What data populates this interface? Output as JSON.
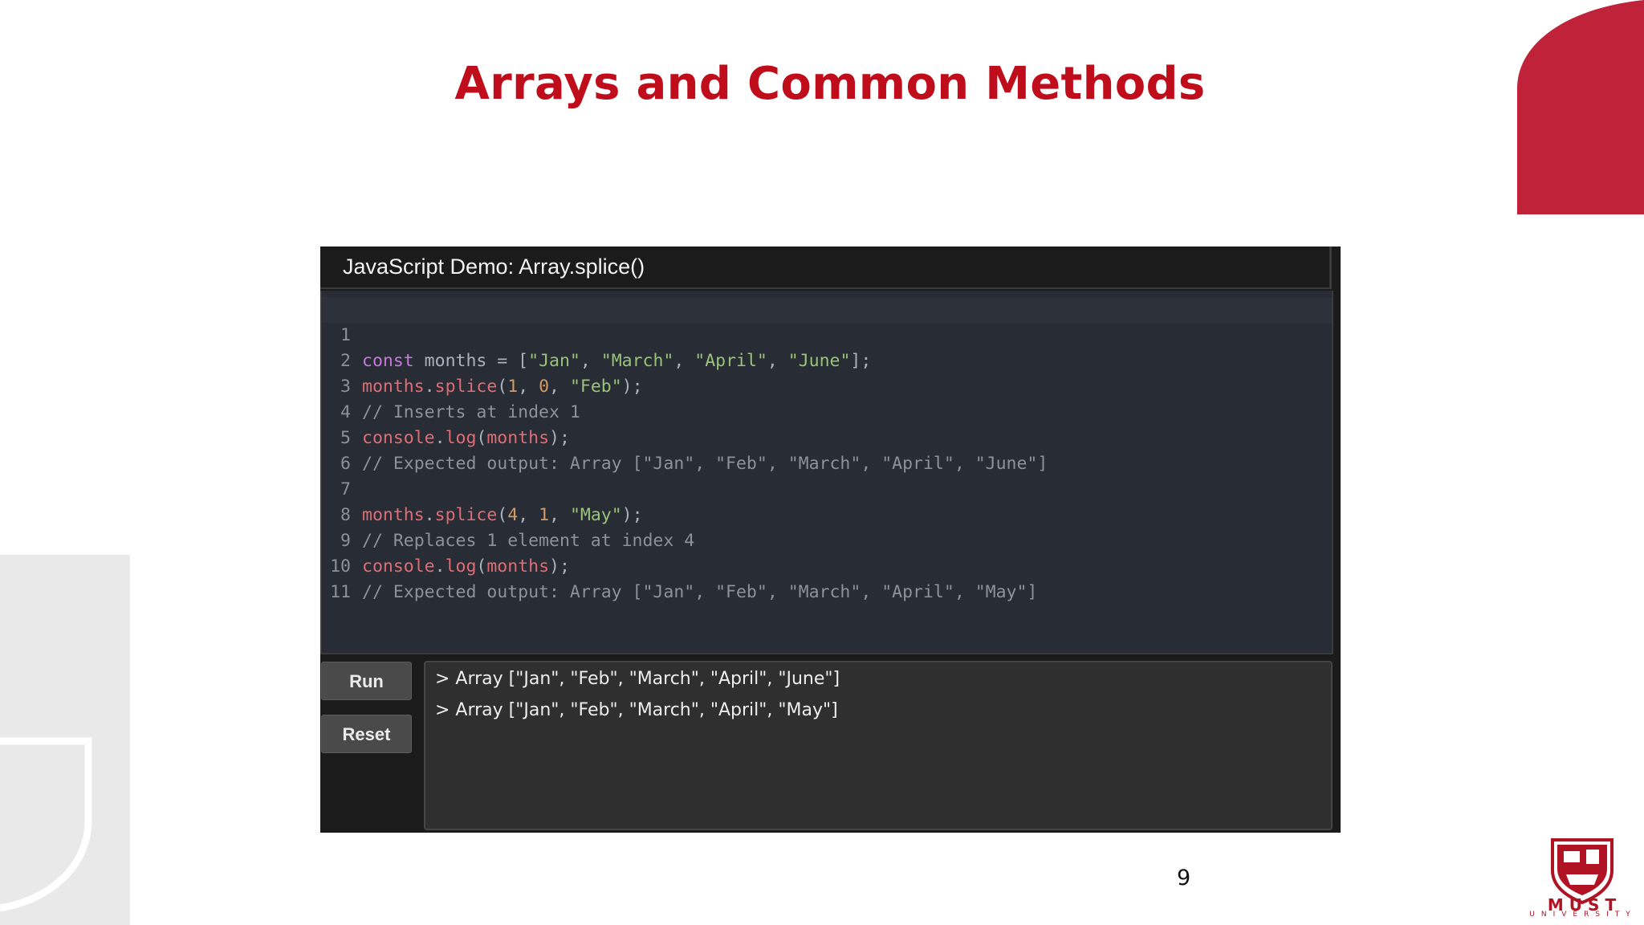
{
  "slide": {
    "title": "Arrays and Common Methods",
    "page_number": "9",
    "brand_color": "#c00d1c"
  },
  "logo": {
    "name": "MUST",
    "sub": "UNIVERSITY"
  },
  "demo": {
    "title": "JavaScript Demo: Array.splice()",
    "lines": [
      {
        "n": "1",
        "text": "const months = [\"Jan\", \"March\", \"April\", \"June\"];"
      },
      {
        "n": "2",
        "text": "months.splice(1, 0, \"Feb\");"
      },
      {
        "n": "3",
        "text": "// Inserts at index 1"
      },
      {
        "n": "4",
        "text": "console.log(months);"
      },
      {
        "n": "5",
        "text": "// Expected output: Array [\"Jan\", \"Feb\", \"March\", \"April\", \"June\"]"
      },
      {
        "n": "6",
        "text": ""
      },
      {
        "n": "7",
        "text": "months.splice(4, 1, \"May\");"
      },
      {
        "n": "8",
        "text": "// Replaces 1 element at index 4"
      },
      {
        "n": "9",
        "text": "console.log(months);"
      },
      {
        "n": "10",
        "text": "// Expected output: Array [\"Jan\", \"Feb\", \"March\", \"April\", \"May\"]"
      },
      {
        "n": "11",
        "text": ""
      }
    ],
    "run_label": "Run",
    "reset_label": "Reset",
    "console_output": [
      "> Array [\"Jan\", \"Feb\", \"March\", \"April\", \"June\"]",
      "> Array [\"Jan\", \"Feb\", \"March\", \"April\", \"May\"]"
    ]
  }
}
